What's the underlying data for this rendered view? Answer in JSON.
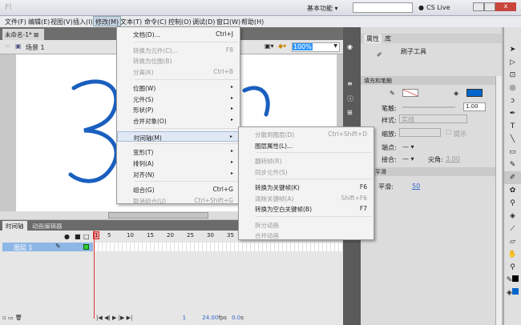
{
  "titlebar": {
    "logo": "Fl",
    "workspace": "基本功能 ▾",
    "search_placeholder": "",
    "cslive": "CS Live"
  },
  "menubar": [
    "文件(F)",
    "编辑(E)",
    "视图(V)",
    "插入(I)",
    "修改(M)",
    "文本(T)",
    "命令(C)",
    "控制(O)",
    "调试(D)",
    "窗口(W)",
    "帮助(H)"
  ],
  "document": {
    "tab": "未命名-1*",
    "scene": "场景 1",
    "zoom": "100%"
  },
  "modify_menu": [
    {
      "label": "文档(D)...",
      "shortcut": "Ctrl+J",
      "enabled": true
    },
    {
      "sep": true
    },
    {
      "label": "转换为元件(C)...",
      "shortcut": "F8",
      "enabled": false
    },
    {
      "label": "转换为位图(B)",
      "shortcut": "",
      "enabled": false
    },
    {
      "label": "分离(K)",
      "shortcut": "Ctrl+B",
      "enabled": false
    },
    {
      "sep": true
    },
    {
      "label": "位图(W)",
      "sub": true,
      "enabled": true
    },
    {
      "label": "元件(S)",
      "sub": true,
      "enabled": true
    },
    {
      "label": "形状(P)",
      "sub": true,
      "enabled": true
    },
    {
      "label": "合并对象(O)",
      "sub": true,
      "enabled": true
    },
    {
      "sep": true
    },
    {
      "label": "时间轴(M)",
      "sub": true,
      "enabled": true,
      "selected": true
    },
    {
      "sep": true
    },
    {
      "label": "变形(T)",
      "sub": true,
      "enabled": true
    },
    {
      "label": "排列(A)",
      "sub": true,
      "enabled": true
    },
    {
      "label": "对齐(N)",
      "sub": true,
      "enabled": true
    },
    {
      "sep": true
    },
    {
      "label": "组合(G)",
      "shortcut": "Ctrl+G",
      "enabled": true
    },
    {
      "label": "取消组合(U)",
      "shortcut": "Ctrl+Shift+G",
      "enabled": false
    }
  ],
  "timeline_menu": [
    {
      "label": "分散到图层(D)",
      "shortcut": "Ctrl+Shift+D",
      "enabled": false
    },
    {
      "label": "图层属性(L)...",
      "shortcut": "",
      "enabled": true
    },
    {
      "sep": true
    },
    {
      "label": "翻转帧(R)",
      "shortcut": "",
      "enabled": false
    },
    {
      "label": "同步元件(S)",
      "shortcut": "",
      "enabled": false
    },
    {
      "sep": true
    },
    {
      "label": "转换为关键帧(K)",
      "shortcut": "F6",
      "enabled": true
    },
    {
      "label": "清除关键帧(A)",
      "shortcut": "Shift+F6",
      "enabled": false
    },
    {
      "label": "转换为空白关键帧(B)",
      "shortcut": "F7",
      "enabled": true
    },
    {
      "sep": true
    },
    {
      "label": "拆分动画",
      "shortcut": "",
      "enabled": false
    },
    {
      "label": "合并动画",
      "shortcut": "",
      "enabled": false
    }
  ],
  "timeline": {
    "tabs": [
      "时间轴",
      "动画编辑器"
    ],
    "layer": "图层 1",
    "frame_numbers": [
      "1",
      "5",
      "10",
      "15",
      "20",
      "25",
      "30",
      "35"
    ],
    "current_frame": "1",
    "fps": "24.00",
    "fps_unit": "fps",
    "time": "0.0",
    "time_unit": "s"
  },
  "properties": {
    "tabs": [
      "属性",
      "库"
    ],
    "tool_name": "刷子工具",
    "section_fill": "填充和笔触",
    "stroke_label": "笔触:",
    "stroke_value": "1.00",
    "style_label": "样式:",
    "style_value": "实线",
    "scale_label": "缩放:",
    "hint_label": "提示",
    "cap_label": "端点:",
    "join_label": "接合:",
    "miter_label": "尖角:",
    "miter_value": "3.00",
    "section_smooth": "平滑",
    "smooth_label": "平滑:",
    "smooth_value": "50",
    "fill_color": "#0066cc"
  },
  "stroke_color": "#1a5fbf"
}
